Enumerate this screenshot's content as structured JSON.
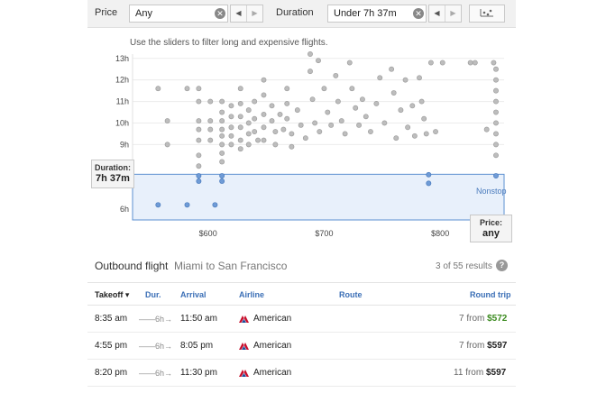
{
  "filters": {
    "price_label": "Price",
    "price_value": "Any",
    "duration_label": "Duration",
    "duration_value": "Under 7h 37m",
    "clear_glyph": "✕",
    "prev_glyph": "◀",
    "next_glyph": "▶"
  },
  "hint": "Use the sliders to filter long and expensive flights.",
  "chart_data": {
    "type": "scatter",
    "xlabel": "",
    "ylabel": "",
    "x_ticks": [
      "$600",
      "$700",
      "$800"
    ],
    "y_ticks": [
      "6h",
      "9h",
      "10h",
      "11h",
      "12h",
      "13h"
    ],
    "xlim": [
      535,
      855
    ],
    "ylim": [
      5.5,
      13.2
    ],
    "duration_threshold_hours": 7.62,
    "series": [
      {
        "color": "#bdbdbd",
        "points": [
          [
            557,
            11.6
          ],
          [
            565,
            10.1
          ],
          [
            565,
            9.0
          ],
          [
            582,
            11.6
          ],
          [
            592,
            11.6
          ],
          [
            592,
            11.0
          ],
          [
            592,
            10.1
          ],
          [
            592,
            9.7
          ],
          [
            592,
            9.2
          ],
          [
            592,
            8.5
          ],
          [
            592,
            8.0
          ],
          [
            602,
            11.0
          ],
          [
            602,
            10.1
          ],
          [
            602,
            9.7
          ],
          [
            602,
            9.2
          ],
          [
            612,
            11.0
          ],
          [
            612,
            10.5
          ],
          [
            612,
            10.1
          ],
          [
            612,
            9.7
          ],
          [
            612,
            9.4
          ],
          [
            612,
            9.0
          ],
          [
            612,
            8.6
          ],
          [
            612,
            8.2
          ],
          [
            620,
            10.8
          ],
          [
            620,
            10.3
          ],
          [
            620,
            9.8
          ],
          [
            620,
            9.4
          ],
          [
            620,
            9.0
          ],
          [
            628,
            11.6
          ],
          [
            628,
            10.9
          ],
          [
            628,
            10.3
          ],
          [
            628,
            9.8
          ],
          [
            628,
            9.2
          ],
          [
            628,
            8.8
          ],
          [
            635,
            10.6
          ],
          [
            635,
            10.0
          ],
          [
            635,
            9.5
          ],
          [
            635,
            9.0
          ],
          [
            640,
            11.0
          ],
          [
            640,
            10.2
          ],
          [
            640,
            9.6
          ],
          [
            643,
            9.2
          ],
          [
            648,
            12.0
          ],
          [
            648,
            11.3
          ],
          [
            648,
            10.4
          ],
          [
            648,
            9.8
          ],
          [
            648,
            9.2
          ],
          [
            655,
            10.8
          ],
          [
            655,
            10.1
          ],
          [
            658,
            9.6
          ],
          [
            658,
            9.0
          ],
          [
            662,
            10.4
          ],
          [
            665,
            9.7
          ],
          [
            668,
            11.6
          ],
          [
            668,
            10.9
          ],
          [
            668,
            10.2
          ],
          [
            672,
            9.5
          ],
          [
            672,
            8.9
          ],
          [
            677,
            10.6
          ],
          [
            680,
            9.9
          ],
          [
            684,
            9.3
          ],
          [
            688,
            13.2
          ],
          [
            688,
            12.4
          ],
          [
            690,
            11.1
          ],
          [
            692,
            10.0
          ],
          [
            695,
            12.9
          ],
          [
            696,
            9.6
          ],
          [
            700,
            11.6
          ],
          [
            703,
            10.5
          ],
          [
            706,
            9.9
          ],
          [
            710,
            12.2
          ],
          [
            712,
            11.0
          ],
          [
            715,
            10.1
          ],
          [
            718,
            9.5
          ],
          [
            722,
            12.8
          ],
          [
            724,
            11.6
          ],
          [
            727,
            10.7
          ],
          [
            730,
            9.9
          ],
          [
            733,
            11.1
          ],
          [
            736,
            10.3
          ],
          [
            740,
            9.6
          ],
          [
            745,
            10.9
          ],
          [
            748,
            12.1
          ],
          [
            752,
            10.0
          ],
          [
            758,
            12.5
          ],
          [
            760,
            11.4
          ],
          [
            762,
            9.3
          ],
          [
            766,
            10.6
          ],
          [
            770,
            12.0
          ],
          [
            772,
            9.8
          ],
          [
            776,
            10.8
          ],
          [
            778,
            9.4
          ],
          [
            782,
            12.1
          ],
          [
            784,
            11.0
          ],
          [
            786,
            10.2
          ],
          [
            788,
            9.5
          ],
          [
            792,
            12.8
          ],
          [
            796,
            9.6
          ],
          [
            802,
            12.8
          ],
          [
            826,
            12.8
          ],
          [
            830,
            12.8
          ],
          [
            840,
            9.7
          ],
          [
            846,
            12.8
          ],
          [
            848,
            12.5
          ],
          [
            848,
            12.0
          ],
          [
            848,
            11.5
          ],
          [
            848,
            11.0
          ],
          [
            848,
            10.5
          ],
          [
            848,
            10.0
          ],
          [
            848,
            9.5
          ],
          [
            848,
            9.0
          ],
          [
            848,
            8.5
          ]
        ]
      },
      {
        "color": "#6f9bd6",
        "points": [
          [
            592,
            7.55
          ],
          [
            592,
            7.3
          ],
          [
            612,
            7.55
          ],
          [
            612,
            7.3
          ],
          [
            790,
            7.6
          ],
          [
            790,
            7.2
          ],
          [
            848,
            7.55
          ],
          [
            557,
            6.2
          ],
          [
            582,
            6.2
          ],
          [
            606,
            6.2
          ]
        ]
      }
    ]
  },
  "duration_handle": {
    "label": "Duration:",
    "value": "7h 37m"
  },
  "price_handle": {
    "label": "Price:",
    "value": "any"
  },
  "nonstop_label": "Nonstop",
  "results": {
    "title": "Outbound flight",
    "route": "Miami to San Francisco",
    "count": "3 of 55 results",
    "help_glyph": "?",
    "columns": {
      "takeoff": "Takeoff ▾",
      "duration": "Dur.",
      "arrival": "Arrival",
      "airline": "Airline",
      "route": "Route",
      "round_trip": "Round trip"
    },
    "rows": [
      {
        "takeoff": "8:35 am",
        "duration": "6h",
        "arrival": "11:50 am",
        "airline": "American",
        "options": "7 from",
        "price": "$572"
      },
      {
        "takeoff": "4:55 pm",
        "duration": "6h",
        "arrival": "8:05 pm",
        "airline": "American",
        "options": "7 from",
        "price": "$597"
      },
      {
        "takeoff": "8:20 pm",
        "duration": "6h",
        "arrival": "11:30 pm",
        "airline": "American",
        "options": "11 from",
        "price": "$597"
      }
    ]
  },
  "colors": {
    "accent": "#3b6fb6",
    "low_price": "#3a8a1e",
    "filter_band": "#e8f0fb"
  }
}
